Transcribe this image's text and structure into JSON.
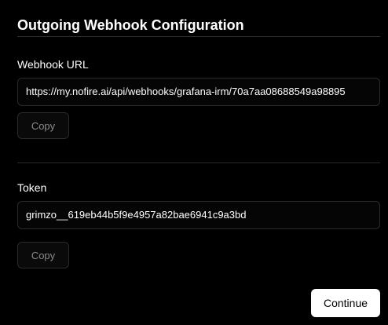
{
  "dialog": {
    "title": "Outgoing Webhook Configuration"
  },
  "webhook": {
    "label": "Webhook URL",
    "value": "https://my.nofire.ai/api/webhooks/grafana-irm/70a7aa08688549a98895",
    "copy_label": "Copy"
  },
  "token": {
    "label": "Token",
    "value": "grimzo__619eb44b5f9e4957a82bae6941c9a3bd",
    "copy_label": "Copy"
  },
  "actions": {
    "continue_label": "Continue"
  },
  "colors": {
    "background": "#000000",
    "border": "#2a2a2a",
    "primary_button_bg": "#ffffff",
    "muted_text": "#8a8a8a"
  }
}
